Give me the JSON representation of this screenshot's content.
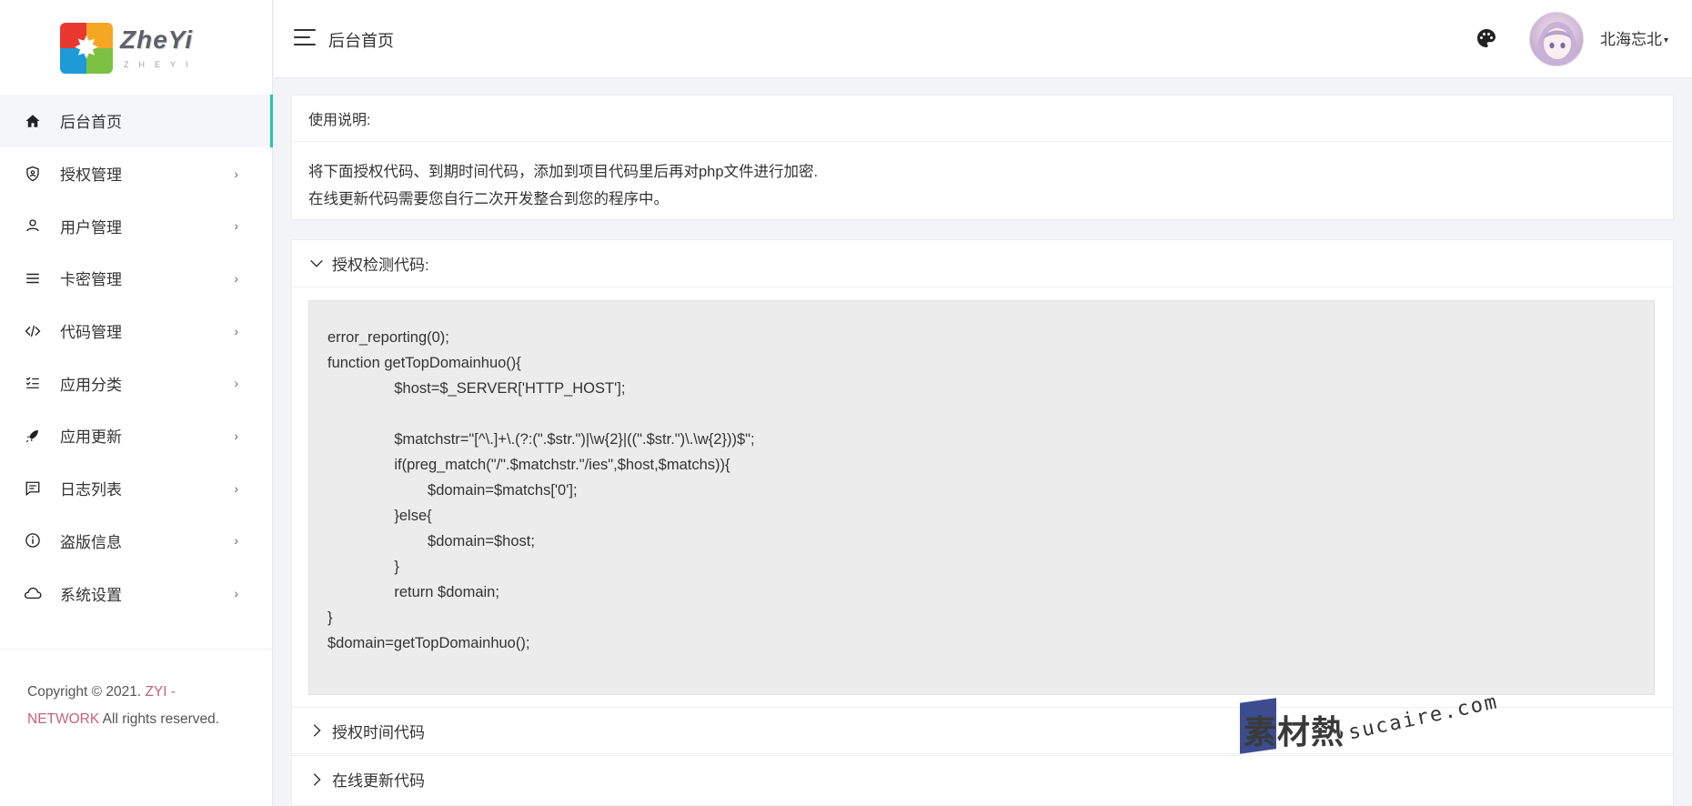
{
  "brand": {
    "logo_text": "ZheYi",
    "logo_subtext": "ZHEYI"
  },
  "sidebar": {
    "items": [
      {
        "label": "后台首页",
        "icon": "home-icon",
        "has_arrow": false,
        "active": true
      },
      {
        "label": "授权管理",
        "icon": "shield-icon",
        "has_arrow": true
      },
      {
        "label": "用户管理",
        "icon": "user-icon",
        "has_arrow": true
      },
      {
        "label": "卡密管理",
        "icon": "list-icon",
        "has_arrow": true
      },
      {
        "label": "代码管理",
        "icon": "code-icon",
        "has_arrow": true
      },
      {
        "label": "应用分类",
        "icon": "category-icon",
        "has_arrow": true
      },
      {
        "label": "应用更新",
        "icon": "rocket-icon",
        "has_arrow": true
      },
      {
        "label": "日志列表",
        "icon": "message-icon",
        "has_arrow": true
      },
      {
        "label": "盗版信息",
        "icon": "info-icon",
        "has_arrow": true
      },
      {
        "label": "系统设置",
        "icon": "cloud-icon",
        "has_arrow": true
      }
    ],
    "arrow_glyph": "›",
    "copyright_prefix": "Copyright © 2021. ",
    "copyright_brand": "ZYI - NETWORK",
    "copyright_suffix": " All rights reserved."
  },
  "header": {
    "title": "后台首页",
    "username": "北海忘北",
    "caret": "▾"
  },
  "notice": {
    "title": "使用说明:",
    "line1": "将下面授权代码、到期时间代码，添加到项目代码里后再对php文件进行加密.",
    "line2": "在线更新代码需要您自行二次开发整合到您的程序中。"
  },
  "accordion": [
    {
      "title": "授权检测代码:",
      "expanded": true
    },
    {
      "title": "授权时间代码",
      "expanded": false
    },
    {
      "title": "在线更新代码",
      "expanded": false
    }
  ],
  "code": {
    "lines": [
      "error_reporting(0);",
      "function getTopDomainhuo(){",
      "\t\t$host=$_SERVER['HTTP_HOST'];",
      "",
      "\t\t$matchstr=\"[^\\.]+\\.(?:(\".$str.\")|\\w{2}|((\".$str.\")\\.\\w{2}))$\";",
      "\t\tif(preg_match(\"/\".$matchstr.\"/ies\",$host,$matchs)){",
      "\t\t\t$domain=$matchs['0'];",
      "\t\t}else{",
      "\t\t\t$domain=$host;",
      "\t\t}",
      "\t\treturn $domain;",
      "}",
      "$domain=getTopDomainhuo();"
    ]
  },
  "watermark": {
    "cn": "素材熱",
    "en": "sucaire.com"
  },
  "colors": {
    "accent": "#2bc1b3",
    "brand_link": "#c7617d",
    "code_bg": "#ececec"
  }
}
